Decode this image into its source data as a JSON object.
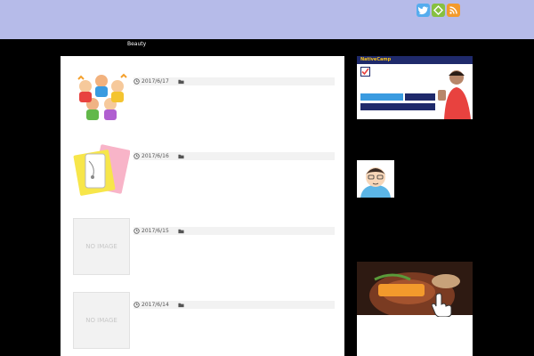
{
  "header": {
    "site_title": "",
    "site_description": "",
    "social": [
      {
        "name": "twitter-icon",
        "color": "#55acee"
      },
      {
        "name": "feedly-icon",
        "color": "#87c040"
      },
      {
        "name": "rss-icon",
        "color": "#f39a2c"
      }
    ]
  },
  "nav": {
    "items": [
      {
        "label": ""
      },
      {
        "label": ""
      },
      {
        "label": ""
      },
      {
        "label": ""
      },
      {
        "label": "Beauty"
      },
      {
        "label": ""
      },
      {
        "label": ""
      },
      {
        "label": ""
      },
      {
        "label": ""
      },
      {
        "label": ""
      }
    ]
  },
  "posts": [
    {
      "title": "",
      "date": "2017/6/17",
      "category": "",
      "excerpt": "",
      "more": "",
      "thumbnail": "children-illustration"
    },
    {
      "title": "",
      "date": "2017/6/16",
      "category": "",
      "excerpt": "",
      "more": "",
      "thumbnail": "phone-notebook-illustration"
    },
    {
      "title": "",
      "date": "2017/6/15",
      "category": "",
      "excerpt": "",
      "more": "",
      "thumbnail": "NO IMAGE"
    },
    {
      "title": "",
      "date": "2017/6/14",
      "category": "",
      "excerpt": "",
      "more": "",
      "thumbnail": "NO IMAGE"
    }
  ],
  "sidebar": {
    "ad_top": {
      "brand": "NativeCamp",
      "headline": "",
      "sub1": "",
      "sub2": "",
      "sub3": ""
    },
    "link": "",
    "profile": {
      "title": "",
      "lines": [
        "",
        ""
      ]
    },
    "ad_bottom": {
      "button": "",
      "line1": "",
      "line2": "",
      "logo": ""
    }
  },
  "colors": {
    "header_bg": "#b6bbe9",
    "title": "#1a2a9c",
    "page_bg": "#000000",
    "accent_orange": "#f39a2c"
  }
}
